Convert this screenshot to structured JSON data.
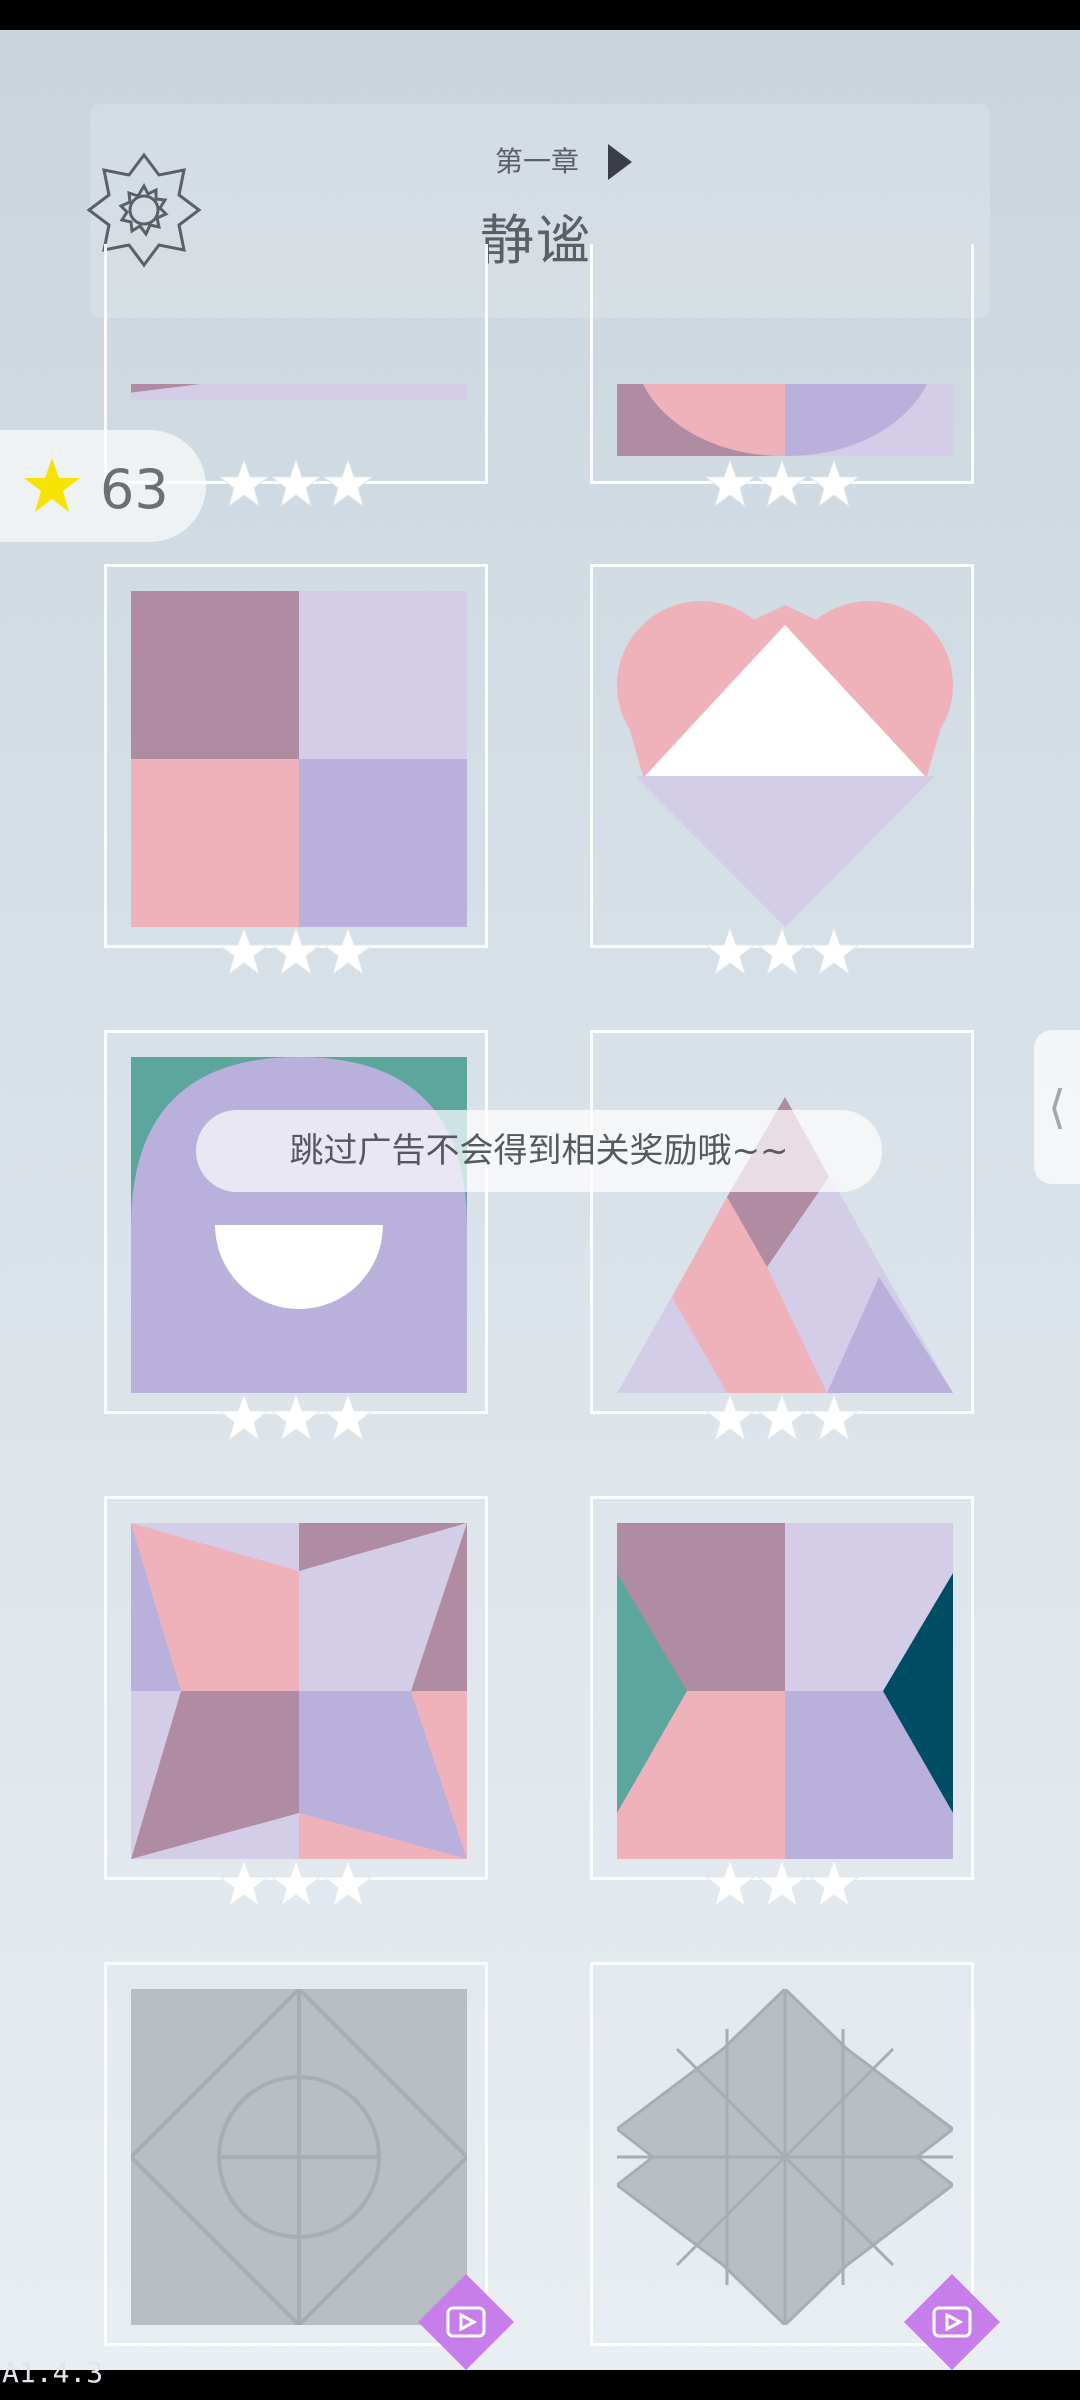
{
  "header": {
    "chapter": "第一章",
    "title": "静谧"
  },
  "stars_total": "63",
  "toast": "跳过广告不会得到相关奖励哦~~",
  "version": "A1.4.3",
  "side_handle_glyph": "⟨",
  "colors": {
    "mauve": "#b08ca2",
    "pink": "#efb2bb",
    "lavender": "#d4cde8",
    "purple": "#bab0dc",
    "teal": "#5da69d",
    "deep_teal": "#004d66",
    "locked": "#b8bec4"
  },
  "levels": [
    {
      "id": "level-partial-left",
      "stars": 3,
      "locked": false
    },
    {
      "id": "level-partial-right",
      "stars": 3,
      "locked": false
    },
    {
      "id": "level-square",
      "stars": 3,
      "locked": false
    },
    {
      "id": "level-heart",
      "stars": 3,
      "locked": false
    },
    {
      "id": "level-face",
      "stars": 3,
      "locked": false
    },
    {
      "id": "level-mountain",
      "stars": 3,
      "locked": false
    },
    {
      "id": "level-star",
      "stars": 3,
      "locked": false
    },
    {
      "id": "level-bowtie",
      "stars": 3,
      "locked": false
    },
    {
      "id": "level-locked-circle",
      "stars": 0,
      "locked": true
    },
    {
      "id": "level-locked-cross",
      "stars": 0,
      "locked": true
    }
  ],
  "icons": {
    "settings": "gear-icon",
    "chapter_next": "play-triangle-icon",
    "star": "star-icon",
    "ad": "video-ad-icon",
    "side": "chevron-left-icon"
  }
}
